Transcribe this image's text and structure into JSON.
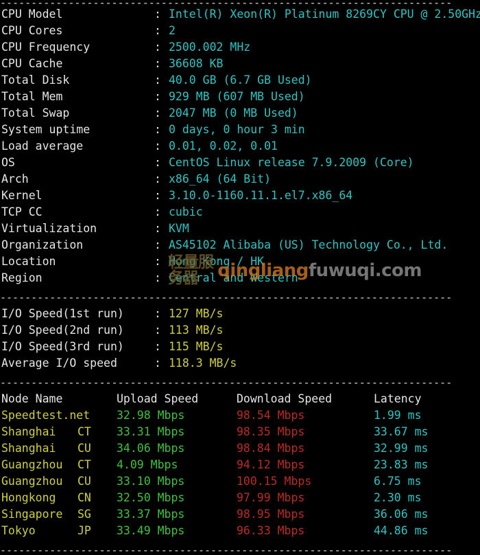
{
  "separator": "-------------------------------------------------------------------------",
  "colon": ":",
  "system_info": [
    {
      "label": "CPU Model",
      "value": "Intel(R) Xeon(R) Platinum 8269CY CPU @ 2.50GHz"
    },
    {
      "label": "CPU Cores",
      "value": "2"
    },
    {
      "label": "CPU Frequency",
      "value": "2500.002 MHz"
    },
    {
      "label": "CPU Cache",
      "value": "36608 KB"
    },
    {
      "label": "Total Disk",
      "value": "40.0 GB (6.7 GB Used)"
    },
    {
      "label": "Total Mem",
      "value": "929 MB (607 MB Used)"
    },
    {
      "label": "Total Swap",
      "value": "2047 MB (0 MB Used)"
    },
    {
      "label": "System uptime",
      "value": "0 days, 0 hour 3 min"
    },
    {
      "label": "Load average",
      "value": "0.01, 0.02, 0.01"
    },
    {
      "label": "OS",
      "value": "CentOS Linux release 7.9.2009 (Core)"
    },
    {
      "label": "Arch",
      "value": "x86_64 (64 Bit)"
    },
    {
      "label": "Kernel",
      "value": "3.10.0-1160.11.1.el7.x86_64"
    },
    {
      "label": "TCP CC",
      "value": "cubic"
    },
    {
      "label": "Virtualization",
      "value": "KVM"
    },
    {
      "label": "Organization",
      "value": "AS45102 Alibaba (US) Technology Co., Ltd."
    },
    {
      "label": "Location",
      "value": "Hong Kong / HK"
    },
    {
      "label": "Region",
      "value": "Central and Western"
    }
  ],
  "io_speed": [
    {
      "label": "I/O Speed(1st run)",
      "value": "127 MB/s"
    },
    {
      "label": "I/O Speed(2nd run)",
      "value": "113 MB/s"
    },
    {
      "label": "I/O Speed(3rd run)",
      "value": "115 MB/s"
    },
    {
      "label": "Average I/O speed",
      "value": "118.3 MB/s"
    }
  ],
  "speedtest": {
    "headers": {
      "node": "Node Name",
      "isp": "",
      "upload": "Upload Speed",
      "download": "Download Speed",
      "latency": "Latency"
    },
    "rows": [
      {
        "node": "Speedtest.net",
        "isp": "",
        "upload": "32.98 Mbps",
        "download": "98.54 Mbps",
        "latency": "1.99 ms"
      },
      {
        "node": "Shanghai",
        "isp": "CT",
        "upload": "33.31 Mbps",
        "download": "98.35 Mbps",
        "latency": "33.67 ms"
      },
      {
        "node": "Shanghai",
        "isp": "CU",
        "upload": "34.06 Mbps",
        "download": "98.84 Mbps",
        "latency": "32.99 ms"
      },
      {
        "node": "Guangzhou",
        "isp": "CT",
        "upload": "4.09 Mbps",
        "download": "94.12 Mbps",
        "latency": "23.83 ms"
      },
      {
        "node": "Guangzhou",
        "isp": "CU",
        "upload": "33.10 Mbps",
        "download": "100.15 Mbps",
        "latency": "6.75 ms"
      },
      {
        "node": "Hongkong",
        "isp": "CN",
        "upload": "32.50 Mbps",
        "download": "97.99 Mbps",
        "latency": "2.30 ms"
      },
      {
        "node": "Singapore",
        "isp": "SG",
        "upload": "33.37 Mbps",
        "download": "98.95 Mbps",
        "latency": "36.06 ms"
      },
      {
        "node": "Tokyo",
        "isp": "JP",
        "upload": "33.49 Mbps",
        "download": "96.33 Mbps",
        "latency": "44.86 ms"
      }
    ]
  },
  "watermark": {
    "cn_text": "轻量服务器",
    "domain_brand": "qingliang",
    "domain_suffix": "fuwuqi.com"
  },
  "colors": {
    "background": "#000000",
    "label": "#e6e6e6",
    "value_cyan": "#2fc4c4",
    "value_yellow": "#cfcf3d",
    "upload_green": "#3fc13f",
    "download_red": "#b92b26",
    "separator": "#d9d9d9",
    "watermark_orange": "#c9761f",
    "watermark_gray": "#8f8f8f"
  }
}
